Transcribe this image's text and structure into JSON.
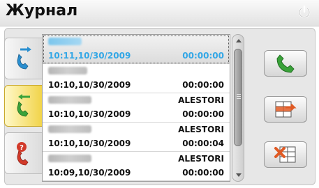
{
  "header": {
    "title": "Журнал",
    "power_icon": "power-icon"
  },
  "tabs": [
    {
      "name": "outgoing",
      "icon": "outgoing-call-icon",
      "active": false
    },
    {
      "name": "incoming",
      "icon": "incoming-call-icon",
      "active": true
    },
    {
      "name": "missed",
      "icon": "missed-call-icon",
      "active": false
    }
  ],
  "calls": [
    {
      "name": "",
      "datetime": "10:11,10/30/2009",
      "duration": "00:00:00",
      "selected": true
    },
    {
      "name": "",
      "datetime": "10:10,10/30/2009",
      "duration": "00:00:00",
      "selected": false
    },
    {
      "name": "ALESTORI",
      "datetime": "10:10,10/30/2009",
      "duration": "00:00:00",
      "selected": false
    },
    {
      "name": "ALESTORI",
      "datetime": "10:10,10/30/2009",
      "duration": "00:00:04",
      "selected": false
    },
    {
      "name": "ALESTORI",
      "datetime": "10:09,10/30/2009",
      "duration": "00:00:00",
      "selected": false
    }
  ],
  "actions": [
    {
      "name": "call-button",
      "icon": "phone-icon"
    },
    {
      "name": "delete-entry-button",
      "icon": "delete-row-icon"
    },
    {
      "name": "delete-all-button",
      "icon": "delete-all-icon"
    }
  ],
  "colors": {
    "selected_text": "#33a7e6",
    "active_tab": "#f1d44a",
    "phone_green": "#3aa23a",
    "missed_red": "#d23a2a"
  }
}
